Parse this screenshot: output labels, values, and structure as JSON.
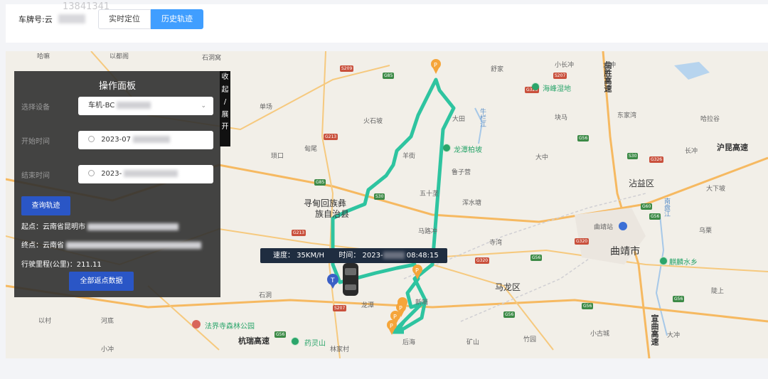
{
  "topbar": {
    "plate_label": "车牌号:云",
    "watermark": "13841341",
    "tabs": [
      {
        "label": "实时定位",
        "active": false
      },
      {
        "label": "历史轨迹",
        "active": true
      }
    ]
  },
  "panel": {
    "title": "操作面板",
    "device_label": "选择设备",
    "device_value": "车机-BC",
    "start_label": "开始时间",
    "start_value": "2023-07",
    "end_label": "结束时间",
    "end_value": "2023-",
    "query_button": "查询轨迹",
    "start_point": "起点：云南省昆明市",
    "end_point": "终点：云南省",
    "mileage": "行驶里程(公里)：211.11",
    "all_button": "全部返点数据",
    "collapse_chars": [
      "收",
      "起",
      "/",
      "展",
      "开"
    ]
  },
  "tooltip": {
    "speed": "速度： 35KM/H",
    "time_prefix": "时间： 2023-",
    "time_suffix": "08:48:15"
  },
  "map": {
    "places": [
      {
        "t": "寻甸回族彝",
        "c": "big"
      },
      {
        "t": "族自治县",
        "c": "big"
      },
      {
        "t": "曲靖市",
        "c": "big"
      },
      {
        "t": "沾益区",
        "c": "big"
      },
      {
        "t": "马龙区",
        "c": "big"
      },
      {
        "t": "龙潭柏坡",
        "c": "green"
      },
      {
        "t": "海峰湿地",
        "c": "green"
      },
      {
        "t": "麒麟水乡",
        "c": "green"
      },
      {
        "t": "法界寺森林公园",
        "c": "green"
      },
      {
        "t": "药灵山",
        "c": "green"
      },
      {
        "t": "曲靖站",
        "c": ""
      },
      {
        "t": "杭瑞高速",
        "c": "hw"
      },
      {
        "t": "沪昆高速",
        "c": "hw"
      },
      {
        "t": "曲胜高速",
        "c": "hw"
      },
      {
        "t": "宣曲高速",
        "c": "hw"
      },
      {
        "t": "南盘江",
        "c": ""
      },
      {
        "t": "牛栏江",
        "c": ""
      },
      {
        "t": "火石坡",
        "c": ""
      },
      {
        "t": "单场",
        "c": ""
      },
      {
        "t": "羊街",
        "c": ""
      },
      {
        "t": "甸尾",
        "c": ""
      },
      {
        "t": "五十垄",
        "c": ""
      },
      {
        "t": "马路冲",
        "c": ""
      },
      {
        "t": "寺湾",
        "c": ""
      },
      {
        "t": "鲁子营",
        "c": ""
      },
      {
        "t": "浑水塘",
        "c": ""
      },
      {
        "t": "大中",
        "c": ""
      },
      {
        "t": "长冲",
        "c": ""
      },
      {
        "t": "大下坡",
        "c": ""
      },
      {
        "t": "乌栗",
        "c": ""
      },
      {
        "t": "陡上",
        "c": ""
      },
      {
        "t": "哈拉谷",
        "c": ""
      },
      {
        "t": "东家湾",
        "c": ""
      },
      {
        "t": "块马",
        "c": ""
      },
      {
        "t": "小长冲",
        "c": ""
      },
      {
        "t": "舒家",
        "c": ""
      },
      {
        "t": "石洞窝",
        "c": ""
      },
      {
        "t": "以村",
        "c": ""
      },
      {
        "t": "河底",
        "c": ""
      },
      {
        "t": "小冲",
        "c": ""
      },
      {
        "t": "林家村",
        "c": ""
      },
      {
        "t": "后海",
        "c": ""
      },
      {
        "t": "矿山",
        "c": ""
      },
      {
        "t": "竹园",
        "c": ""
      },
      {
        "t": "小古城",
        "c": ""
      },
      {
        "t": "大冲",
        "c": ""
      },
      {
        "t": "龙潭",
        "c": ""
      },
      {
        "t": "新哨",
        "c": ""
      },
      {
        "t": "大田",
        "c": ""
      },
      {
        "t": "石洞",
        "c": ""
      },
      {
        "t": "琐口",
        "c": ""
      },
      {
        "t": "哈嘛",
        "c": ""
      },
      {
        "t": "以都阁",
        "c": ""
      },
      {
        "t": "大冲",
        "c": ""
      }
    ],
    "roads": [
      "S209",
      "G85",
      "S207",
      "G213",
      "G85",
      "G56",
      "S30",
      "G326",
      "G60",
      "G56",
      "S30",
      "G326",
      "G213",
      "G320",
      "G56",
      "G320",
      "G56",
      "G56",
      "G56",
      "S207",
      "G56"
    ]
  }
}
